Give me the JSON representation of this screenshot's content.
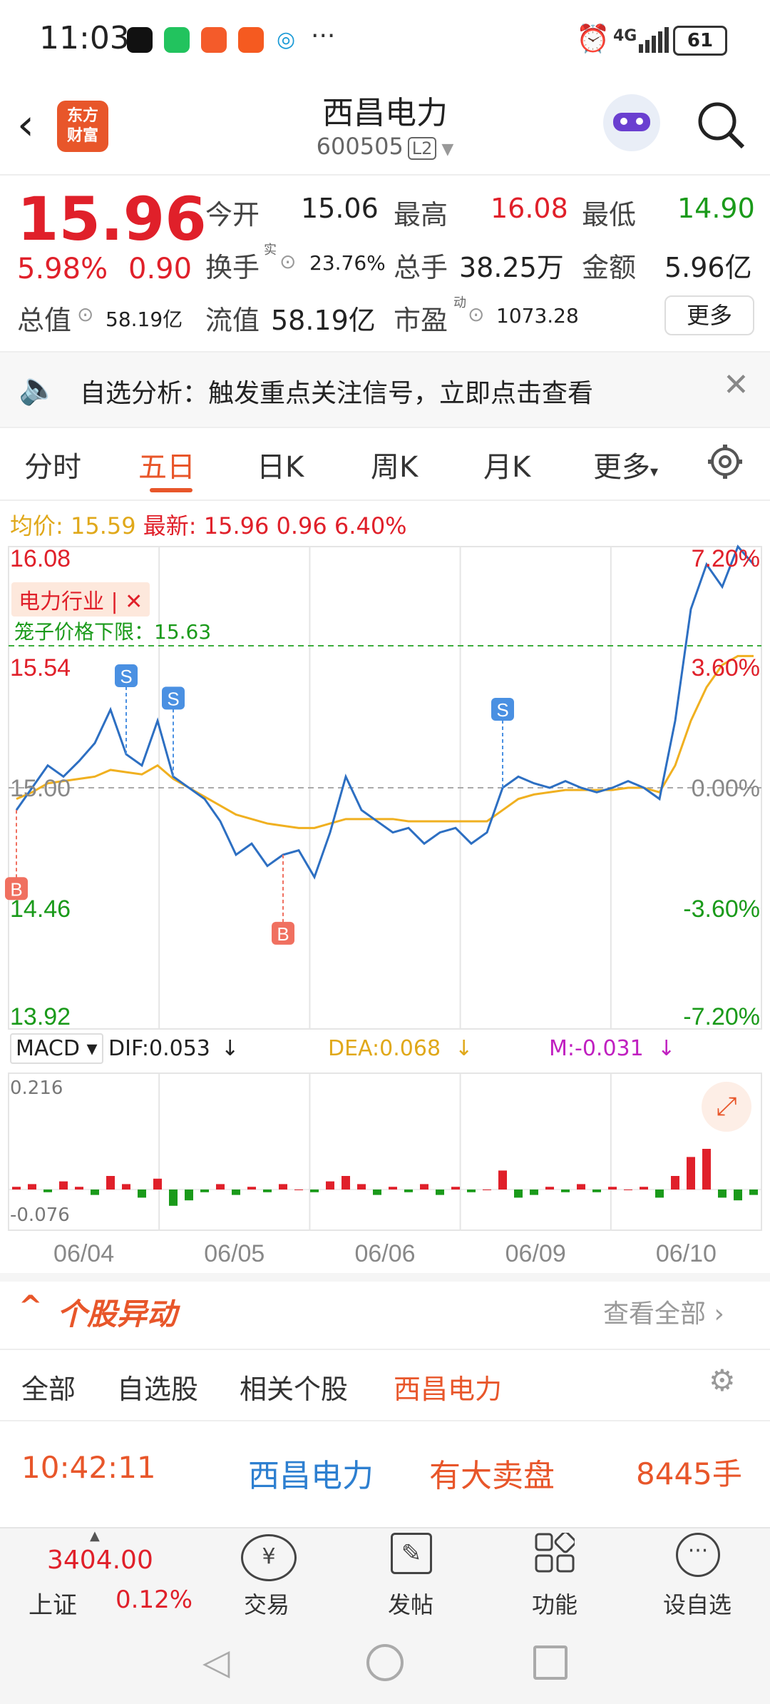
{
  "status": {
    "time": "11:03",
    "signal": "4G",
    "battery": "61"
  },
  "header": {
    "logo_line1": "东方",
    "logo_line2": "财富",
    "title": "西昌电力",
    "code": "600505",
    "level": "L2"
  },
  "quote": {
    "price": "15.96",
    "change_pct": "5.98%",
    "change": "0.90",
    "open_label": "今开",
    "open": "15.06",
    "high_label": "最高",
    "high": "16.08",
    "low_label": "最低",
    "low": "14.90",
    "turnover_label": "换手",
    "turnover_sup": "实",
    "turnover": "23.76%",
    "volume_label": "总手",
    "volume": "38.25万",
    "amount_label": "金额",
    "amount": "5.96亿",
    "mktcap_label": "总值",
    "mktcap": "58.19亿",
    "float_label": "流值",
    "float": "58.19亿",
    "pe_label": "市盈",
    "pe_sup": "动",
    "pe": "1073.28",
    "more": "更多"
  },
  "notice": {
    "text": "自选分析：触发重点关注信号，立即点击查看"
  },
  "tabs": [
    "分时",
    "五日",
    "日K",
    "周K",
    "月K",
    "更多"
  ],
  "summary": {
    "avg_label": "均价:",
    "avg": "15.59",
    "latest_label": "最新:",
    "latest": "15.96",
    "chg": "0.96",
    "pct": "6.40%"
  },
  "chart_data": {
    "type": "line",
    "y_left_ticks": [
      "16.08",
      "15.54",
      "15.00",
      "14.46",
      "13.92"
    ],
    "y_right_ticks": [
      "7.20%",
      "3.60%",
      "0.00%",
      "-3.60%",
      "-7.20%"
    ],
    "x_ticks": [
      "06/04",
      "06/05",
      "06/06",
      "06/09",
      "06/10"
    ],
    "industry_tag": "电力行业 | ✕",
    "cage_label": "笼子价格下限：15.63",
    "markers": [
      "S",
      "S",
      "S",
      "B",
      "B"
    ],
    "price_series": [
      14.9,
      15.0,
      15.1,
      15.05,
      15.12,
      15.2,
      15.35,
      15.15,
      15.1,
      15.3,
      15.05,
      15.0,
      14.95,
      14.85,
      14.7,
      14.75,
      14.65,
      14.7,
      14.72,
      14.6,
      14.8,
      15.05,
      14.9,
      14.85,
      14.8,
      14.82,
      14.75,
      14.8,
      14.82,
      14.75,
      14.8,
      15.0,
      15.05,
      15.02,
      15.0,
      15.03,
      15.0,
      14.98,
      15.0,
      15.03,
      15.0,
      14.95,
      15.3,
      15.8,
      16.0,
      15.9,
      16.08,
      16.0
    ],
    "avg_series": [
      14.95,
      14.98,
      15.02,
      15.03,
      15.04,
      15.05,
      15.08,
      15.07,
      15.06,
      15.1,
      15.04,
      15.0,
      14.96,
      14.92,
      14.88,
      14.86,
      14.84,
      14.83,
      14.82,
      14.82,
      14.84,
      14.86,
      14.86,
      14.86,
      14.86,
      14.85,
      14.85,
      14.85,
      14.85,
      14.85,
      14.85,
      14.9,
      14.95,
      14.97,
      14.98,
      14.99,
      14.99,
      14.99,
      14.99,
      15.0,
      15.0,
      14.98,
      15.1,
      15.3,
      15.45,
      15.55,
      15.59,
      15.59
    ],
    "ylim": [
      13.92,
      16.08
    ],
    "macd": {
      "label": "MACD",
      "dif": "DIF:0.053",
      "dea": "DEA:0.068",
      "m": "M:-0.031",
      "top": "0.216",
      "bottom": "-0.076",
      "hist": [
        0.01,
        0.02,
        -0.01,
        0.03,
        0.01,
        -0.02,
        0.05,
        0.02,
        -0.03,
        0.04,
        -0.06,
        -0.04,
        -0.01,
        0.02,
        -0.02,
        0.01,
        -0.01,
        0.02,
        0.0,
        -0.01,
        0.03,
        0.05,
        0.02,
        -0.02,
        0.01,
        -0.01,
        0.02,
        -0.02,
        0.01,
        -0.01,
        0.0,
        0.07,
        -0.03,
        -0.02,
        0.01,
        -0.01,
        0.02,
        -0.01,
        0.01,
        0.0,
        0.01,
        -0.03,
        0.05,
        0.12,
        0.15,
        -0.03,
        -0.04,
        -0.02
      ]
    }
  },
  "alerts": {
    "title": "个股异动",
    "view_all": "查看全部",
    "filters": [
      "全部",
      "自选股",
      "相关个股",
      "西昌电力"
    ],
    "row": {
      "time": "10:42:11",
      "name": "西昌电力",
      "type": "有大卖盘",
      "qty": "8445手"
    }
  },
  "bottom_nav": {
    "index_value": "3404.00",
    "index_name": "上证",
    "index_pct": "0.12%",
    "items": [
      "交易",
      "发帖",
      "功能",
      "设自选"
    ]
  }
}
